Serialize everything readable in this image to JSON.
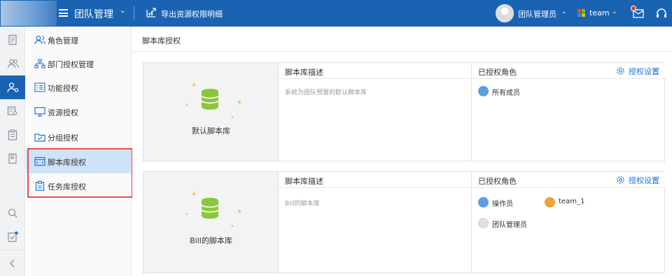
{
  "header": {
    "app_title": "团队管理",
    "export_label": "导出资源权限明细",
    "user_name": "团队管理员",
    "team_name": "team"
  },
  "submenu": {
    "items": [
      {
        "label": "角色管理",
        "icon": "users-icon"
      },
      {
        "label": "部门授权管理",
        "icon": "org-chart-icon"
      },
      {
        "label": "功能授权",
        "icon": "list-icon"
      },
      {
        "label": "资源授权",
        "icon": "monitor-icon"
      },
      {
        "label": "分组授权",
        "icon": "folder-icon"
      },
      {
        "label": "脚本库授权",
        "icon": "script-icon",
        "active": true
      },
      {
        "label": "任务库授权",
        "icon": "clipboard-icon"
      }
    ]
  },
  "main": {
    "breadcrumb": "脚本库授权",
    "libraries": [
      {
        "name": "默认脚本库",
        "desc_header": "脚本库描述",
        "description": "系统为团队预置的默认脚本库",
        "roles_header": "已授权角色",
        "auth_settings_label": "授权设置",
        "roles": [
          {
            "label": "所有成员",
            "kind": "group"
          }
        ]
      },
      {
        "name": "Bill的脚本库",
        "desc_header": "脚本库描述",
        "description": "Bill的脚本库",
        "roles_header": "已授权角色",
        "auth_settings_label": "授权设置",
        "roles": [
          {
            "label": "操作员",
            "kind": "group"
          },
          {
            "label": "team_1",
            "kind": "team"
          },
          {
            "label": "团队管理员",
            "kind": "person"
          }
        ]
      }
    ]
  },
  "colors": {
    "brand_blue": "#1a63b2",
    "link_blue": "#1a73d9",
    "db_green": "#8cc63f",
    "highlight_red": "#e84b4b",
    "active_menu_bg": "#cfe3f8"
  }
}
